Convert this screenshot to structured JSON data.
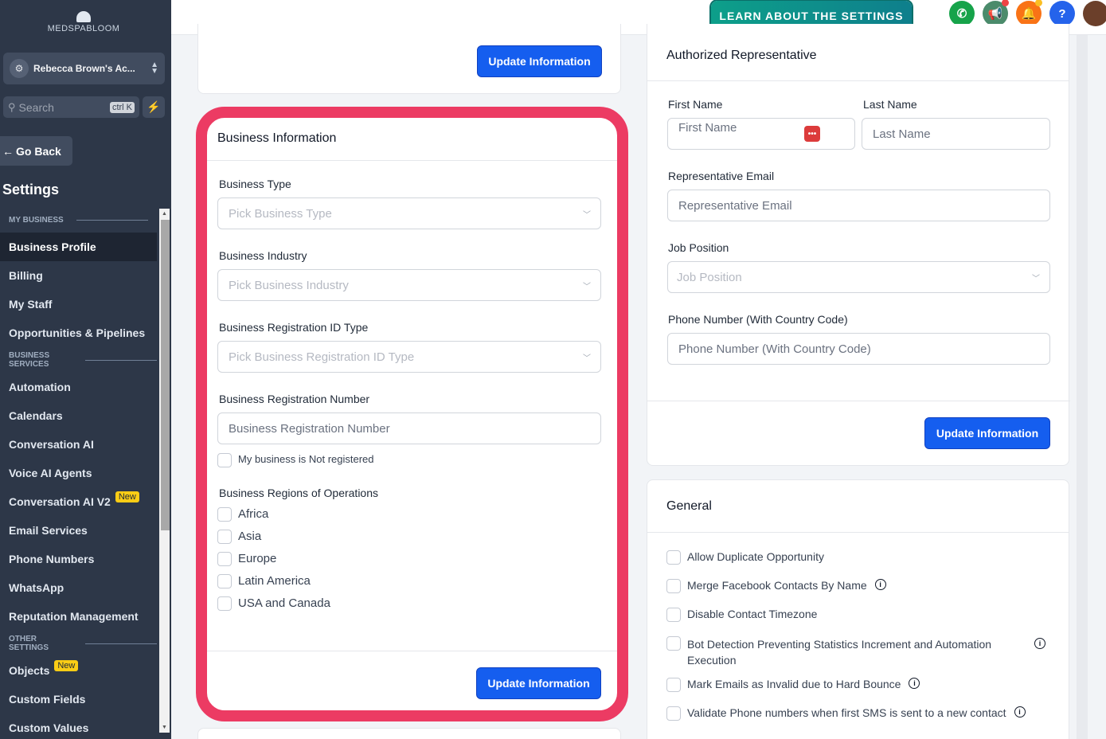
{
  "sidebar": {
    "logo": "MEDSPABLOOM",
    "account_name": "Rebecca Brown's Ac...",
    "search_placeholder": "Search",
    "search_shortcut": "ctrl K",
    "go_back": "Go Back",
    "title": "Settings",
    "sections": [
      {
        "label": "MY BUSINESS",
        "items": [
          {
            "label": "Business Profile",
            "active": true
          },
          {
            "label": "Billing"
          },
          {
            "label": "My Staff"
          },
          {
            "label": "Opportunities & Pipelines"
          }
        ]
      },
      {
        "label": "BUSINESS SERVICES",
        "items": [
          {
            "label": "Automation"
          },
          {
            "label": "Calendars"
          },
          {
            "label": "Conversation AI"
          },
          {
            "label": "Voice AI Agents"
          },
          {
            "label": "Conversation AI V2",
            "badge": "New"
          },
          {
            "label": "Email Services"
          },
          {
            "label": "Phone Numbers"
          },
          {
            "label": "WhatsApp"
          },
          {
            "label": "Reputation Management"
          }
        ]
      },
      {
        "label": "OTHER SETTINGS",
        "items": [
          {
            "label": "Objects",
            "badge": "New"
          },
          {
            "label": "Custom Fields"
          },
          {
            "label": "Custom Values"
          }
        ]
      }
    ]
  },
  "topbar": {
    "learn_button": "LEARN ABOUT THE SETTINGS",
    "icons": [
      {
        "name": "phone-icon",
        "color": "#16a34a"
      },
      {
        "name": "megaphone-icon",
        "color": "#4b8b6b"
      },
      {
        "name": "bell-icon",
        "color": "#f97316"
      },
      {
        "name": "help-icon",
        "color": "#2563eb"
      },
      {
        "name": "user-avatar",
        "color": "#6b3f2a"
      }
    ]
  },
  "top_card": {
    "button": "Update Information"
  },
  "business_info": {
    "title": "Business Information",
    "business_type_label": "Business Type",
    "business_type_placeholder": "Pick Business Type",
    "industry_label": "Business Industry",
    "industry_placeholder": "Pick Business Industry",
    "reg_id_type_label": "Business Registration ID Type",
    "reg_id_type_placeholder": "Pick Business Registration ID Type",
    "reg_number_label": "Business Registration Number",
    "reg_number_placeholder": "Business Registration Number",
    "not_registered": "My business is Not registered",
    "regions_label": "Business Regions of Operations",
    "regions": [
      "Africa",
      "Asia",
      "Europe",
      "Latin America",
      "USA and Canada"
    ],
    "button": "Update Information"
  },
  "authorized_rep": {
    "title": "Authorized Representative",
    "first_name_label": "First Name",
    "first_name_placeholder": "First Name",
    "last_name_label": "Last Name",
    "last_name_placeholder": "Last Name",
    "email_label": "Representative Email",
    "email_placeholder": "Representative Email",
    "job_label": "Job Position",
    "job_placeholder": "Job Position",
    "phone_label": "Phone Number (With Country Code)",
    "phone_placeholder": "Phone Number (With Country Code)",
    "button": "Update Information"
  },
  "general": {
    "title": "General",
    "options": [
      {
        "label": "Allow Duplicate Opportunity",
        "info": false
      },
      {
        "label": "Merge Facebook Contacts By Name",
        "info": true
      },
      {
        "label": "Disable Contact Timezone",
        "info": false
      },
      {
        "label": "Bot Detection Preventing Statistics Increment and Automation Execution",
        "info": true
      },
      {
        "label": "Mark Emails as Invalid due to Hard Bounce",
        "info": true
      },
      {
        "label": "Validate Phone numbers when first SMS is sent to a new contact",
        "info": true
      }
    ]
  }
}
